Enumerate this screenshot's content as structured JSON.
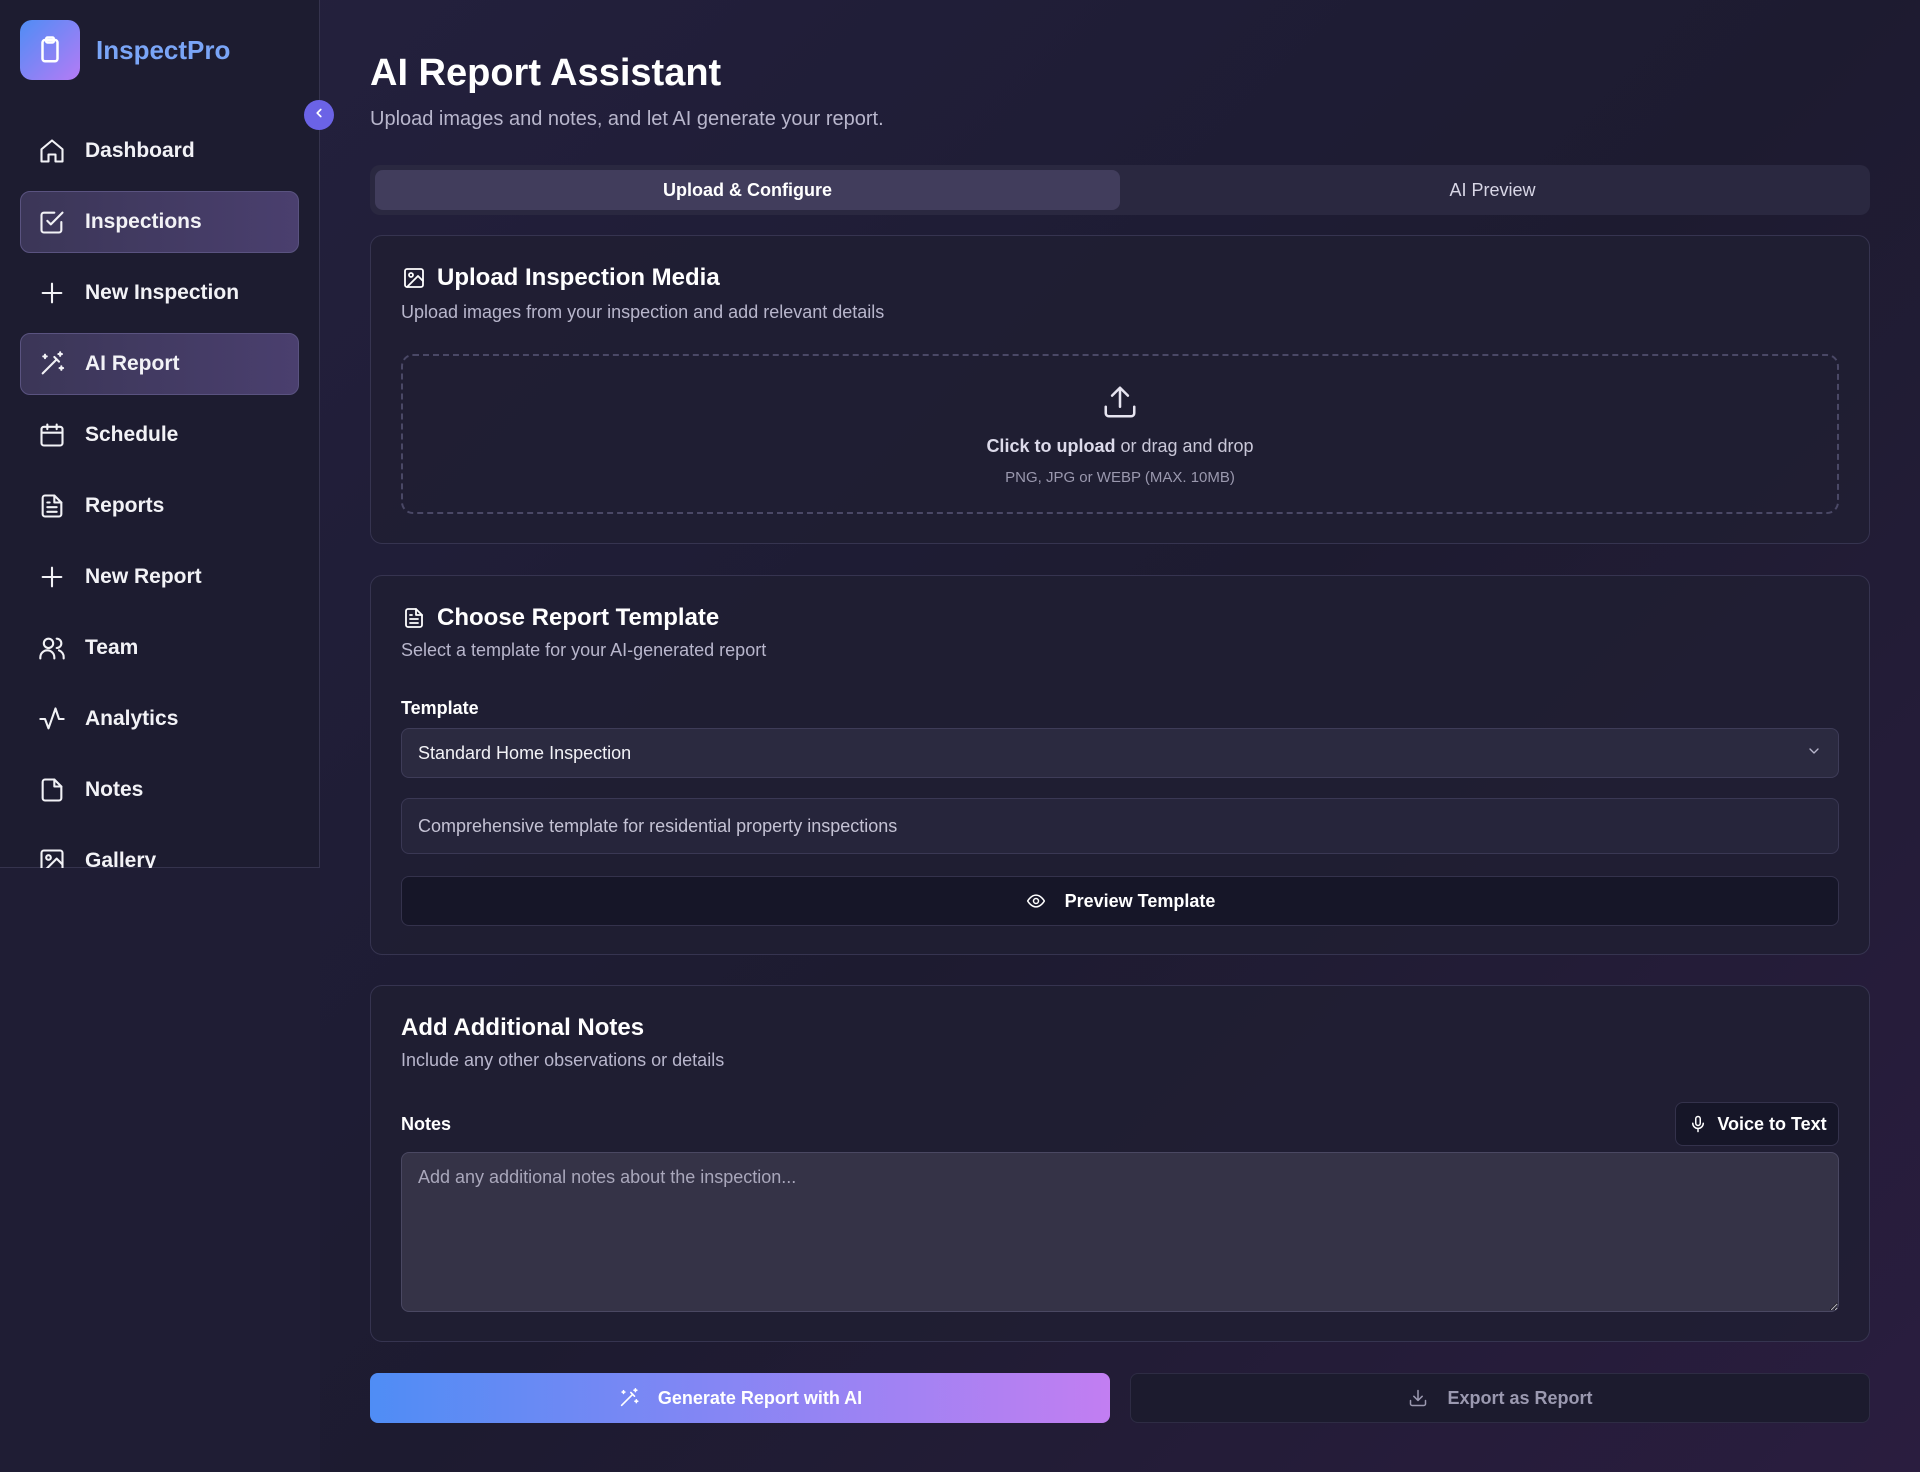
{
  "brand": {
    "name": "InspectPro"
  },
  "sidebar": {
    "items": [
      {
        "label": "Dashboard",
        "icon": "home-icon",
        "active": false
      },
      {
        "label": "Inspections",
        "icon": "clipboard-check-icon",
        "active": true
      },
      {
        "label": "New Inspection",
        "icon": "plus-icon",
        "active": false
      },
      {
        "label": "AI Report",
        "icon": "magic-wand-icon",
        "active": true
      },
      {
        "label": "Schedule",
        "icon": "calendar-icon",
        "active": false
      },
      {
        "label": "Reports",
        "icon": "document-icon",
        "active": false
      },
      {
        "label": "New Report",
        "icon": "plus-icon",
        "active": false
      },
      {
        "label": "Team",
        "icon": "users-icon",
        "active": false
      },
      {
        "label": "Analytics",
        "icon": "activity-icon",
        "active": false
      },
      {
        "label": "Notes",
        "icon": "file-icon",
        "active": false
      },
      {
        "label": "Gallery",
        "icon": "image-icon",
        "active": false
      }
    ]
  },
  "header": {
    "title": "AI Report Assistant",
    "subtitle": "Upload images and notes, and let AI generate your report."
  },
  "tabs": [
    {
      "label": "Upload & Configure",
      "active": true
    },
    {
      "label": "AI Preview",
      "active": false
    }
  ],
  "upload": {
    "title": "Upload Inspection Media",
    "subtitle": "Upload images from your inspection and add relevant details",
    "click_text": "Click to upload",
    "drag_text": " or drag and drop",
    "hint": "PNG, JPG or WEBP (MAX. 10MB)"
  },
  "template": {
    "title": "Choose Report Template",
    "subtitle": "Select a template for your AI-generated report",
    "label": "Template",
    "selected": "Standard Home Inspection",
    "description": "Comprehensive template for residential property inspections",
    "preview_label": "Preview Template"
  },
  "notes": {
    "title": "Add Additional Notes",
    "subtitle": "Include any other observations or details",
    "label": "Notes",
    "voice_label": "Voice to Text",
    "placeholder": "Add any additional notes about the inspection..."
  },
  "actions": {
    "generate_label": "Generate Report with AI",
    "export_label": "Export as Report"
  },
  "colors": {
    "accent_blue": "#4f8df5",
    "accent_purple": "#c27ef2",
    "background": "#1f1d36"
  }
}
